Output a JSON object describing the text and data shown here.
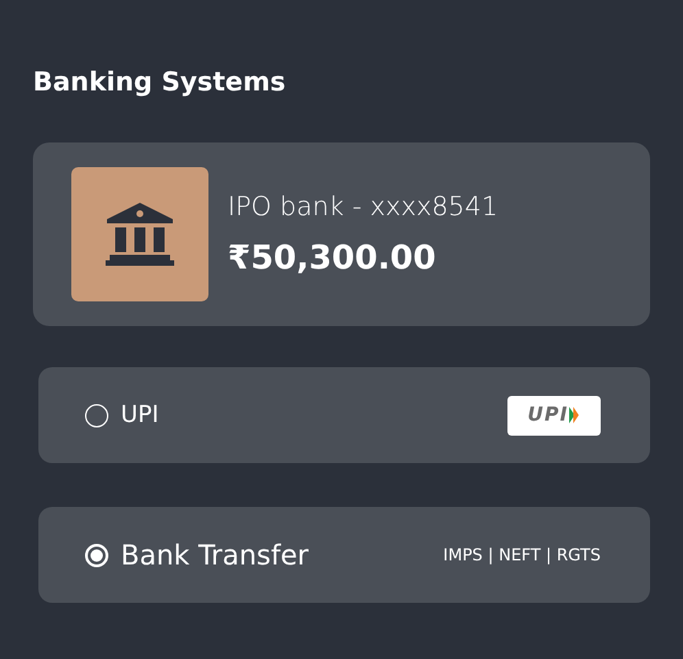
{
  "title": "Banking Systems",
  "account": {
    "name": "IPO bank - xxxx8541",
    "balance": "₹50,300.00"
  },
  "options": [
    {
      "label": "UPI",
      "selected": false,
      "badge": {
        "kind": "logo",
        "text": "UPI"
      }
    },
    {
      "label": "Bank Transfer",
      "selected": true,
      "badge": {
        "kind": "text",
        "text": "IMPS | NEFT | RGTS"
      }
    }
  ]
}
